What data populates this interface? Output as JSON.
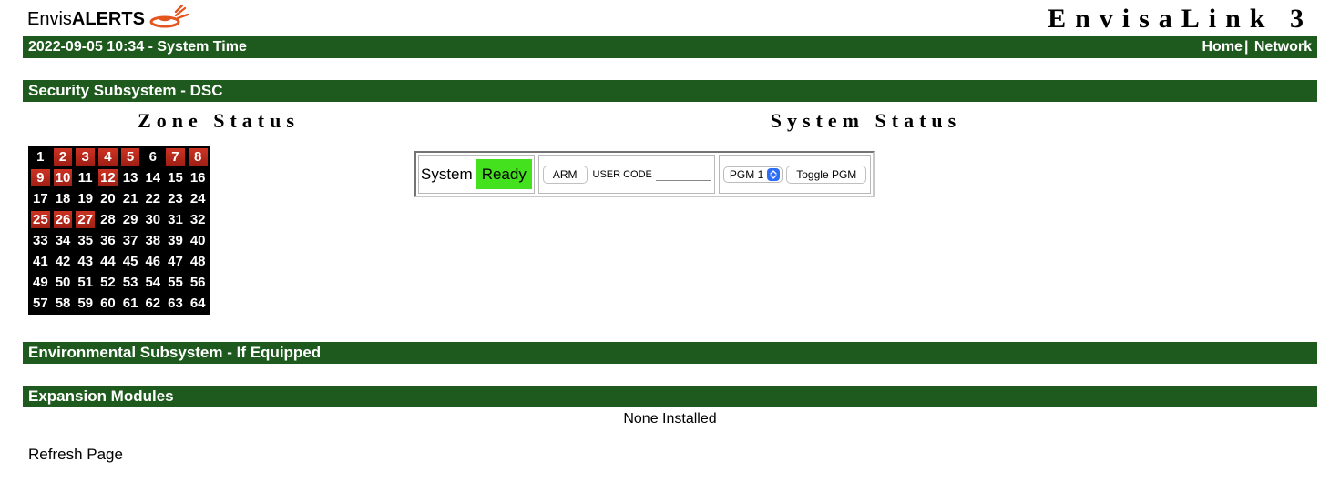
{
  "brand": {
    "prefix": "Envis",
    "suffix": "ALERTS"
  },
  "product_title": "EnvisaLink 3",
  "topbar": {
    "time_text": "2022-09-05 10:34 - System Time",
    "links": {
      "home": "Home",
      "network": "Network",
      "sep": "|"
    }
  },
  "security": {
    "title": "Security Subsystem - DSC",
    "zone_heading": "Zone Status",
    "system_heading": "System Status",
    "zones": {
      "count": 64,
      "active": [
        2,
        3,
        4,
        5,
        7,
        8,
        9,
        10,
        12,
        25,
        26,
        27
      ]
    },
    "panel": {
      "system_label": "System",
      "ready_label": "Ready",
      "arm_button": "ARM",
      "user_code_label": "USER CODE",
      "user_code_value": "",
      "pgm_selected": "PGM 1",
      "toggle_pgm_button": "Toggle PGM"
    }
  },
  "environmental": {
    "title": "Environmental Subsystem - If Equipped"
  },
  "expansion": {
    "title": "Expansion Modules",
    "none_text": "None Installed"
  },
  "refresh_label": "Refresh Page"
}
